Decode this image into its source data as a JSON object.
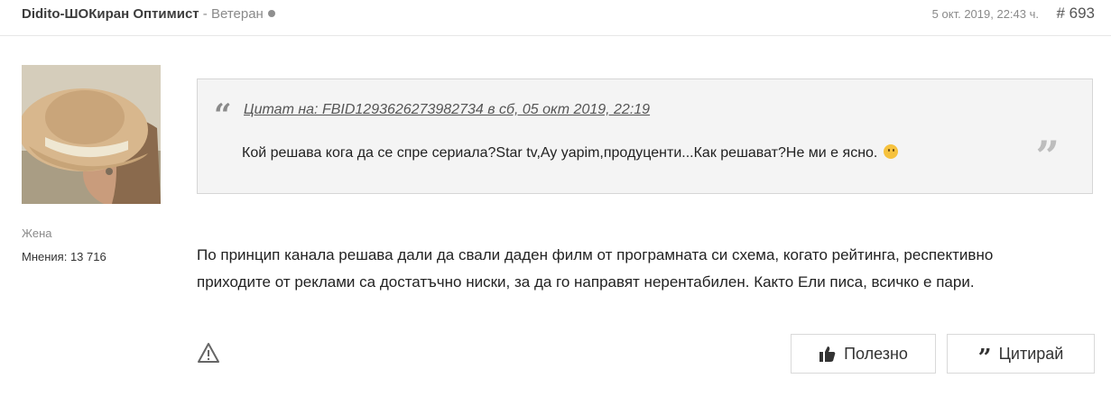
{
  "header": {
    "author": "Didito-ШОКиран Оптимист",
    "separator": " - ",
    "rank": "Ветеран",
    "date": "5 окт. 2019, 22:43 ч.",
    "post_number": "# 693"
  },
  "author_info": {
    "gender": "Жена",
    "posts": "Мнения: 13 716"
  },
  "quote": {
    "cite": "Цитат на: FBID1293626273982734 в сб, 05 окт 2019, 22:19",
    "text": "Кой решава кога да се спре сериала?Star tv,Ay yapim,продуценти...Как решават?Не ми е ясно."
  },
  "body": {
    "line1": "По принцип канала решава дали да свали даден филм от програмната си схема, когато рейтинга, респективно",
    "line2": "приходите от реклами са достатъчно ниски, за да го направят нерентабилен. Както Ели писа, всичко е пари."
  },
  "actions": {
    "like_label": "Полезно",
    "quote_label": "Цитирай"
  },
  "icons": {
    "status": "offline-dot-icon",
    "quote_open": "quote-open-icon",
    "quote_close": "quote-close-icon",
    "emoji": "thinking-face-emoji",
    "report": "warning-triangle-icon",
    "like": "thumbs-up-icon",
    "quote": "quote-icon"
  }
}
